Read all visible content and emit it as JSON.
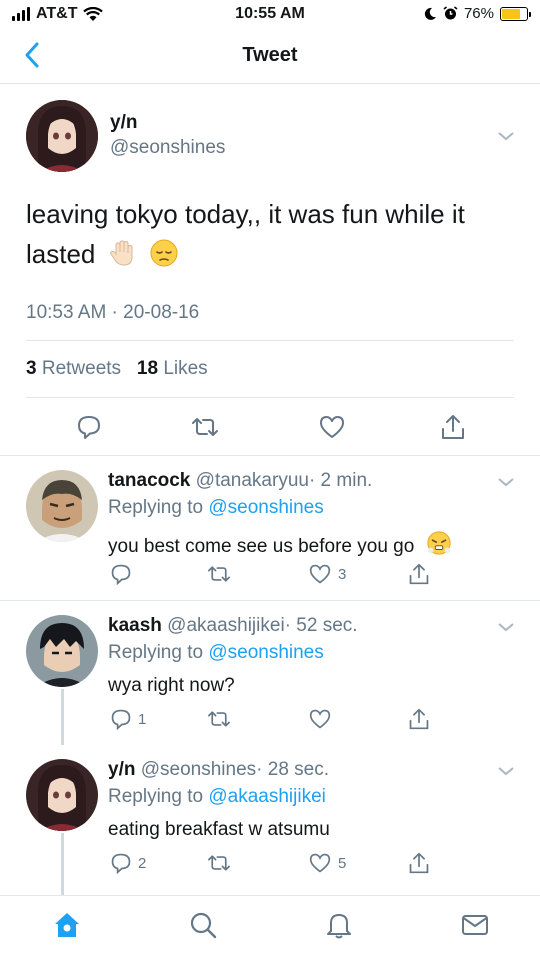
{
  "status_bar": {
    "carrier": "AT&T",
    "time": "10:55 AM",
    "battery_percent_label": "76%",
    "battery_level": 0.76
  },
  "nav": {
    "title": "Tweet"
  },
  "main_tweet": {
    "display_name": "y/n",
    "handle": "@seonshines",
    "text": "leaving tokyo today,, it was fun while it lasted",
    "timestamp": "10:53 AM · 20-08-16",
    "retweets_count": "3",
    "retweets_label": "Retweets",
    "likes_count": "18",
    "likes_label": "Likes"
  },
  "replies": [
    {
      "display_name": "tanacock",
      "handle": "@tanakaryuu",
      "time": "· 2 min.",
      "replying_prefix": "Replying to",
      "replying_to": "@seonshines",
      "text": "you best come see us before you go",
      "reply_count": "",
      "retweet_count": "",
      "like_count": "3"
    },
    {
      "display_name": "kaash",
      "handle": "@akaashijikei",
      "time": "· 52 sec.",
      "replying_prefix": "Replying to",
      "replying_to": "@seonshines",
      "text": "wya right now?",
      "reply_count": "1",
      "retweet_count": "",
      "like_count": ""
    },
    {
      "display_name": "y/n",
      "handle": "@seonshines",
      "time": "· 28 sec.",
      "replying_prefix": "Replying to",
      "replying_to": "@akaashijikei",
      "text": "eating breakfast w atsumu",
      "reply_count": "2",
      "retweet_count": "",
      "like_count": "5"
    }
  ],
  "colors": {
    "accent": "#1da1f2",
    "muted": "#657786",
    "text": "#14171a",
    "divider": "#e1e8ed"
  },
  "icons": [
    "back-arrow-icon",
    "chevron-down-icon",
    "reply-icon",
    "retweet-icon",
    "like-icon",
    "share-icon",
    "home-icon",
    "search-icon",
    "notifications-icon",
    "messages-icon",
    "wave-hand-emoji",
    "pensive-face-emoji",
    "huffing-face-emoji"
  ]
}
